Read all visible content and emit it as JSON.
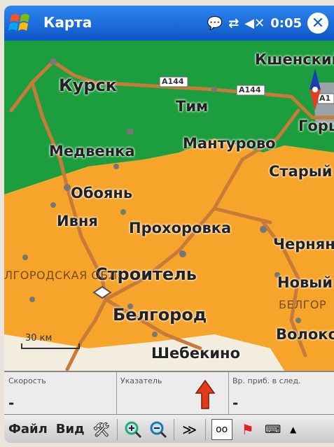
{
  "titlebar": {
    "title": "Карта",
    "time": "0:05"
  },
  "map": {
    "cities": [
      {
        "name": "Курск"
      },
      {
        "name": "Тим"
      },
      {
        "name": "Кшенский"
      },
      {
        "name": "Горшечное"
      },
      {
        "name": "Медвенка"
      },
      {
        "name": "Мантурово"
      },
      {
        "name": "Старый Оскол"
      },
      {
        "name": "Обоянь"
      },
      {
        "name": "Ивня"
      },
      {
        "name": "Прохоровка"
      },
      {
        "name": "Чернянка"
      },
      {
        "name": "Строитель"
      },
      {
        "name": "Новый Оскол"
      },
      {
        "name": "Белгород"
      },
      {
        "name": "Волоконовка"
      },
      {
        "name": "Шебекино"
      }
    ],
    "regions": [
      "ЛГОРОДСКАЯ ОБЛ.",
      "БЕЛГОР"
    ],
    "roads": [
      "A144",
      "A144",
      "A1"
    ],
    "scale": "30 км"
  },
  "info": {
    "speed_label": "Скорость",
    "speed_value": "-",
    "pointer_label": "Указатель",
    "eta_label": "Вр. приб. в след.",
    "eta_value": "-"
  },
  "toolbar": {
    "file": "Файл",
    "view": "Вид"
  },
  "colors": {
    "green": "#1d9e3e",
    "orange": "#f6a42a",
    "road": "#c87a3a",
    "titlebar": "#1762d8"
  }
}
